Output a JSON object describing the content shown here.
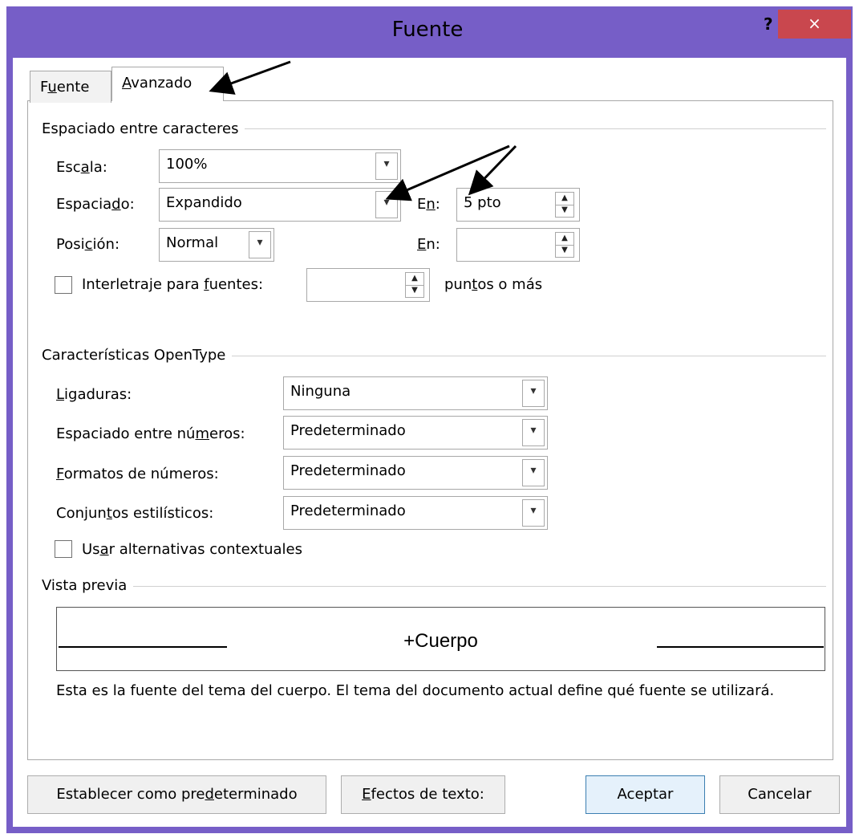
{
  "window": {
    "title": "Fuente",
    "help": "?",
    "close": "×"
  },
  "tabs": [
    {
      "label": "Fuente",
      "underline_index": 1
    },
    {
      "label": "Avanzado",
      "underline_index": 0
    }
  ],
  "spacing_section": {
    "heading": "Espaciado entre caracteres",
    "scale_label": "Escala:",
    "scale_value": "100%",
    "spacing_label": "Espaciado:",
    "spacing_value": "Expandido",
    "spacing_by_label": "En:",
    "spacing_by_value": "5 pto",
    "position_label": "Posición:",
    "position_value": "Normal",
    "position_by_label": "En:",
    "position_by_value": "",
    "kerning_label": "Interletraje para fuentes:",
    "kerning_value": "",
    "kerning_suffix": "puntos o más"
  },
  "opentype_section": {
    "heading": "Características OpenType",
    "ligatures_label": "Ligaduras:",
    "ligatures_value": "Ninguna",
    "number_spacing_label": "Espaciado entre números:",
    "number_spacing_value": "Predeterminado",
    "number_forms_label": "Formatos de números:",
    "number_forms_value": "Predeterminado",
    "stylistic_sets_label": "Conjuntos estilísticos:",
    "stylistic_sets_value": "Predeterminado",
    "contextual_label": "Usar alternativas contextuales"
  },
  "preview_section": {
    "heading": "Vista previa",
    "sample_text": "+Cuerpo",
    "description": "Esta es la fuente del tema del cuerpo. El tema del documento actual define qué fuente se utilizará."
  },
  "buttons": {
    "set_default": "Establecer como predeterminado",
    "text_effects": "Efectos de texto:",
    "ok": "Aceptar",
    "cancel": "Cancelar"
  },
  "colors": {
    "titlebar": "#765ec7",
    "close": "#c9474e"
  },
  "icons": [
    "chevron-down-icon",
    "spin-up-icon",
    "spin-down-icon",
    "annotation-arrow"
  ]
}
